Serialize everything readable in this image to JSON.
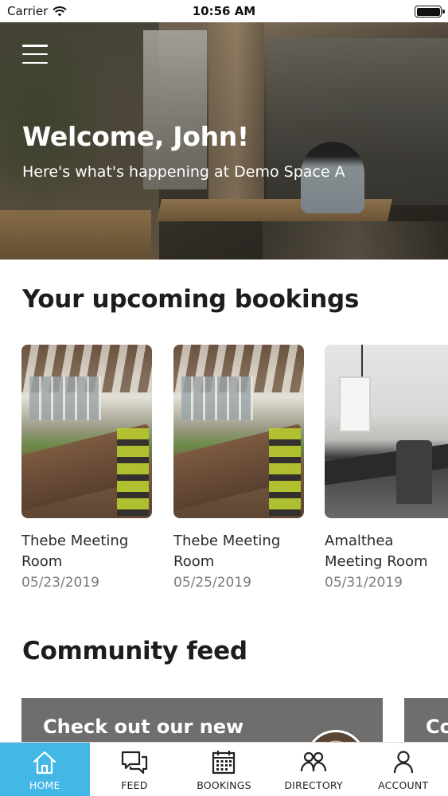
{
  "status_bar": {
    "carrier": "Carrier",
    "time": "10:56 AM",
    "battery_level": 1.0
  },
  "hero": {
    "title": "Welcome, John!",
    "subtitle": "Here's what's happening at Demo Space A"
  },
  "bookings": {
    "title": "Your upcoming bookings",
    "items": [
      {
        "name": "Thebe Meeting Room",
        "date": "05/23/2019",
        "photo": "meeting-room-green-chairs"
      },
      {
        "name": "Thebe Meeting Room",
        "date": "05/25/2019",
        "photo": "meeting-room-green-chairs"
      },
      {
        "name": "Amalthea Meeting Room",
        "date": "05/31/2019",
        "photo": "meeting-room-white"
      }
    ]
  },
  "feed": {
    "title": "Community feed",
    "cards": [
      {
        "text": "Check out our new"
      },
      {
        "text": "Co"
      }
    ]
  },
  "tab_bar": {
    "active_tab": "HOME",
    "active_color": "#43b7e6",
    "tabs": [
      {
        "label": "HOME",
        "icon": "home-icon"
      },
      {
        "label": "FEED",
        "icon": "chat-icon"
      },
      {
        "label": "BOOKINGS",
        "icon": "calendar-icon"
      },
      {
        "label": "DIRECTORY",
        "icon": "people-icon"
      },
      {
        "label": "ACCOUNT",
        "icon": "person-icon"
      }
    ]
  }
}
